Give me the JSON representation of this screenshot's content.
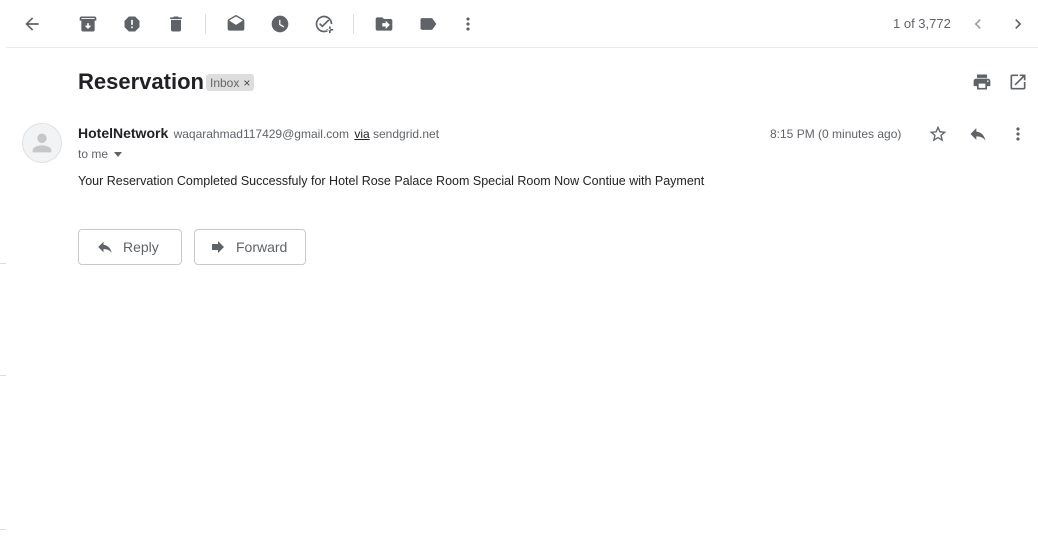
{
  "toolbar": {
    "icons": [
      "back-arrow-icon",
      "archive-icon",
      "report-spam-icon",
      "delete-icon",
      "mark-unread-icon",
      "snooze-icon",
      "add-task-icon",
      "move-to-icon",
      "label-icon",
      "more-vert-icon"
    ],
    "pager_text": "1 of 3,772"
  },
  "email": {
    "subject": "Reservation",
    "label": "Inbox",
    "label_close": "×",
    "sender_name": "HotelNetwork",
    "sender_email": "waqarahmad117429@gmail.com",
    "via_label": "via",
    "via_domain": "sendgrid.net",
    "to_text": "to me",
    "timestamp": "8:15 PM (0 minutes ago)",
    "body": "Your Reservation Completed Successfuly for Hotel Rose Palace Room Special Room Now Contiue with Payment"
  },
  "actions": {
    "reply_label": "Reply",
    "forward_label": "Forward"
  },
  "colors": {
    "icon": "#5f6368",
    "chip_bg": "#dddddd",
    "divider": "#e8eaed"
  }
}
